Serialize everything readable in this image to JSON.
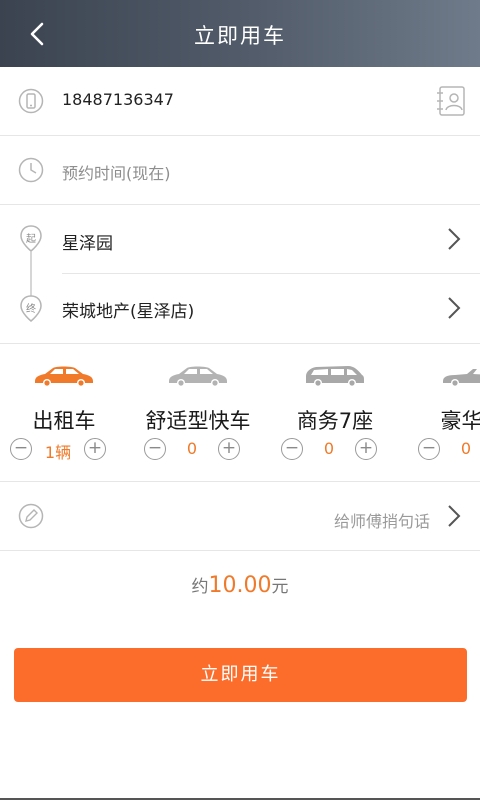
{
  "header": {
    "title": "立即用车"
  },
  "phone": {
    "value": "18487136347"
  },
  "time": {
    "placeholder": "预约时间(现在)"
  },
  "route": {
    "start": "星泽园",
    "end": "荣城地产(星泽店)",
    "start_marker": "起",
    "end_marker": "终"
  },
  "cars": [
    {
      "name": "出租车",
      "count": "1辆",
      "color": "#f07a2a",
      "selected": true
    },
    {
      "name": "舒适型快车",
      "count": "0",
      "color": "#b3b3b3",
      "selected": false
    },
    {
      "name": "商务7座",
      "count": "0",
      "color": "#a8a8a8",
      "selected": false
    },
    {
      "name": "豪华型",
      "count": "0",
      "color": "#a8a8a8",
      "selected": false
    }
  ],
  "stepper": {
    "minus": "−",
    "plus": "+"
  },
  "message": {
    "label": "给师傅捎句话"
  },
  "price": {
    "prefix": "约",
    "amount": "10.00",
    "suffix": "元"
  },
  "submit": {
    "label": "立即用车"
  },
  "colors": {
    "accent": "#fc6d2b",
    "header_start": "#3b4350",
    "header_end": "#6f7b8a"
  }
}
